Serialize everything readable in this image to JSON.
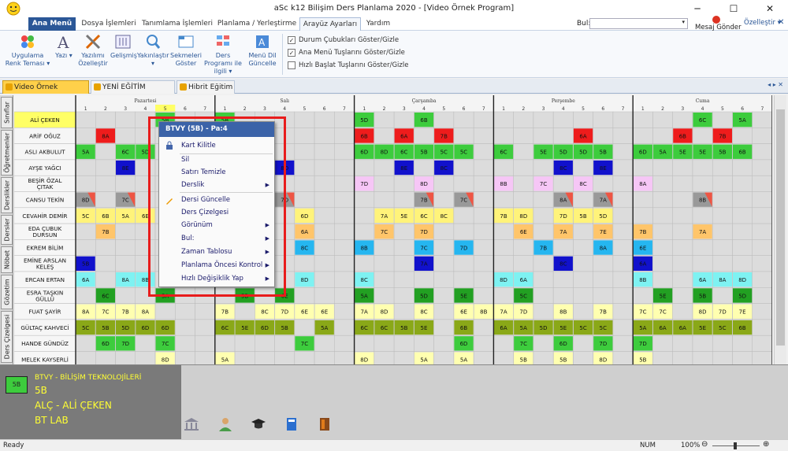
{
  "window": {
    "title": "aSc k12 Bilişim Ders Planlama 2020  - [Video Örnek Program]"
  },
  "menu": {
    "tabs": [
      "Ana Menü",
      "Dosya İşlemleri",
      "Tanımlama İşlemleri",
      "Planlama / Yerleştirme",
      "Arayüz Ayarları",
      "Yardım"
    ],
    "search_label": "Bul:",
    "message": "Mesaj Gönder",
    "settings": "Özelleştir ▾"
  },
  "ribbon": {
    "buttons": [
      "Uygulama Renk Teması ▾",
      "Yazı ▾",
      "Yazılımı Özelleştir",
      "Gelişmiş",
      "Yakınlaştır ▾",
      "Sekmeleri Göster",
      "Ders Programı ile ilgili ▾",
      "Menü Dil Güncelle"
    ],
    "checks": [
      {
        "label": "Durum Çubukları Göster/Gizle",
        "checked": true
      },
      {
        "label": "Ana Menü Tuşlarını Göster/Gizle",
        "checked": true
      },
      {
        "label": "Hızlı Başlat Tuşlarını Göster/Gizle",
        "checked": false
      }
    ]
  },
  "doctabs": [
    "Video Örnek Program",
    "YENİ EĞİTİM SİSTEMİ",
    "Hibrit Eğitim"
  ],
  "sidebar": [
    "Sınıflar",
    "Öğretmenler",
    "Derslikler",
    "Dersler",
    "Nöbet",
    "Gözetim",
    "Ders Çizelgesi"
  ],
  "days": [
    "Pazartesi",
    "Salı",
    "Çarşamba",
    "Perşembe",
    "Cuma"
  ],
  "periods": [
    "1",
    "2",
    "3",
    "4",
    "5",
    "6",
    "7"
  ],
  "teachers": [
    "ALİ ÇEKEN",
    "ARİF OĞUZ",
    "ASLI AKBULUT",
    "AYŞE YAĞCI",
    "BEŞİR ÖZAL ÇITAK",
    "CANSU TEKİN",
    "CEVAHİR DEMİR",
    "EDA ÇUBUK DURSUN",
    "EKREM BİLİM",
    "EMİNE ARSLAN KELEŞ",
    "ERCAN ERTAN",
    "ESRA TAŞKIN GÜLLÜ",
    "FUAT ŞAYİR",
    "GÜLTAÇ KAHVECİ",
    "HANDE GÜNDÜZ",
    "MELEK KAYSERLİ"
  ],
  "schedule": [
    {
      "row": 0,
      "color": "#3dcc3d",
      "cells": [
        [
          0,
          4,
          "5B"
        ],
        [
          1,
          0,
          "5B"
        ],
        [
          2,
          0,
          "5D"
        ],
        [
          2,
          3,
          "6B"
        ],
        [
          4,
          3,
          "6C"
        ],
        [
          4,
          5,
          "5A"
        ]
      ]
    },
    {
      "row": 1,
      "color": "#ee1c1c",
      "cells": [
        [
          0,
          1,
          "8A"
        ],
        [
          2,
          0,
          "6B"
        ],
        [
          2,
          2,
          "6A"
        ],
        [
          2,
          4,
          "7B"
        ],
        [
          3,
          4,
          "6A"
        ],
        [
          4,
          2,
          "6B"
        ],
        [
          4,
          4,
          "7B"
        ]
      ]
    },
    {
      "row": 2,
      "color": "#3dcc3d",
      "cells": [
        [
          0,
          0,
          "5A"
        ],
        [
          0,
          2,
          "6C"
        ],
        [
          0,
          3,
          "5D"
        ],
        [
          2,
          0,
          "6D"
        ],
        [
          2,
          1,
          "8D"
        ],
        [
          2,
          2,
          "6C"
        ],
        [
          2,
          3,
          "5B"
        ],
        [
          2,
          4,
          "5C"
        ],
        [
          2,
          5,
          "5C"
        ],
        [
          3,
          0,
          "6C"
        ],
        [
          3,
          2,
          "5E"
        ],
        [
          3,
          3,
          "5D"
        ],
        [
          3,
          4,
          "5D"
        ],
        [
          3,
          5,
          "5B"
        ],
        [
          4,
          0,
          "6D"
        ],
        [
          4,
          1,
          "5A"
        ],
        [
          4,
          2,
          "5E"
        ],
        [
          4,
          3,
          "5E"
        ],
        [
          4,
          4,
          "5B"
        ],
        [
          4,
          5,
          "6B"
        ]
      ]
    },
    {
      "row": 3,
      "color": "#1111cc",
      "cells": [
        [
          0,
          2,
          "8E"
        ],
        [
          1,
          3,
          "8D"
        ],
        [
          2,
          2,
          "8E"
        ],
        [
          2,
          4,
          "8C"
        ],
        [
          3,
          3,
          "8C"
        ],
        [
          3,
          5,
          "8E"
        ]
      ]
    },
    {
      "row": 4,
      "color": "#f6c6f6",
      "cells": [
        [
          2,
          0,
          "7D"
        ],
        [
          2,
          3,
          "8D"
        ],
        [
          3,
          0,
          "8B"
        ],
        [
          3,
          2,
          "7C"
        ],
        [
          3,
          4,
          "8C"
        ],
        [
          4,
          0,
          "8A"
        ]
      ]
    },
    {
      "row": 5,
      "color": "#999999",
      "cells": [
        [
          0,
          0,
          "8D"
        ],
        [
          0,
          2,
          "7C"
        ],
        [
          1,
          3,
          "7D"
        ],
        [
          2,
          3,
          "7B"
        ],
        [
          2,
          5,
          "7C"
        ],
        [
          3,
          3,
          "8A"
        ],
        [
          3,
          5,
          "7A"
        ],
        [
          4,
          3,
          "8B"
        ]
      ]
    },
    {
      "row": 6,
      "color": "#fff37a",
      "cells": [
        [
          0,
          0,
          "5C"
        ],
        [
          0,
          1,
          "6B"
        ],
        [
          0,
          2,
          "5A"
        ],
        [
          0,
          3,
          "6E"
        ],
        [
          1,
          4,
          "6D"
        ],
        [
          2,
          1,
          "7A"
        ],
        [
          2,
          2,
          "5E"
        ],
        [
          2,
          3,
          "6C"
        ],
        [
          2,
          4,
          "8C"
        ],
        [
          3,
          0,
          "7B"
        ],
        [
          3,
          1,
          "8D"
        ],
        [
          3,
          3,
          "7D"
        ],
        [
          3,
          4,
          "5B"
        ],
        [
          3,
          5,
          "5D"
        ]
      ]
    },
    {
      "row": 7,
      "color": "#ffc56a",
      "cells": [
        [
          0,
          1,
          "7B"
        ],
        [
          1,
          4,
          "6A"
        ],
        [
          2,
          1,
          "7C"
        ],
        [
          2,
          3,
          "7D"
        ],
        [
          3,
          1,
          "6E"
        ],
        [
          3,
          3,
          "7A"
        ],
        [
          3,
          5,
          "7E"
        ],
        [
          4,
          0,
          "7B"
        ],
        [
          4,
          3,
          "7A"
        ]
      ]
    },
    {
      "row": 8,
      "color": "#25b6f0",
      "cells": [
        [
          1,
          4,
          "8C"
        ],
        [
          2,
          0,
          "8B"
        ],
        [
          2,
          3,
          "7C"
        ],
        [
          2,
          5,
          "7D"
        ],
        [
          3,
          2,
          "7B"
        ],
        [
          3,
          5,
          "8A"
        ],
        [
          4,
          0,
          "6E"
        ]
      ]
    },
    {
      "row": 9,
      "color": "#1111cc",
      "cells": [
        [
          0,
          0,
          "5B"
        ],
        [
          2,
          3,
          "7A"
        ],
        [
          3,
          3,
          "8C"
        ],
        [
          4,
          0,
          "6A"
        ]
      ]
    },
    {
      "row": 10,
      "color": "#7ef2f2",
      "cells": [
        [
          0,
          0,
          "6A"
        ],
        [
          0,
          2,
          "8A"
        ],
        [
          0,
          3,
          "8B"
        ],
        [
          1,
          4,
          "8D"
        ],
        [
          2,
          0,
          "8C"
        ],
        [
          3,
          0,
          "8D"
        ],
        [
          3,
          1,
          "6A"
        ],
        [
          4,
          0,
          "8B"
        ],
        [
          4,
          3,
          "6A"
        ],
        [
          4,
          4,
          "8A"
        ],
        [
          4,
          5,
          "8D"
        ]
      ]
    },
    {
      "row": 11,
      "color": "#22a022",
      "cells": [
        [
          0,
          1,
          "6C"
        ],
        [
          0,
          4,
          "5A"
        ],
        [
          1,
          1,
          "5B"
        ],
        [
          1,
          3,
          "6E"
        ],
        [
          2,
          0,
          "5A"
        ],
        [
          2,
          3,
          "5D"
        ],
        [
          2,
          5,
          "5E"
        ],
        [
          3,
          1,
          "5C"
        ],
        [
          4,
          1,
          "5E"
        ],
        [
          4,
          3,
          "5B"
        ],
        [
          4,
          5,
          "5D"
        ]
      ]
    },
    {
      "row": 12,
      "color": "#ffffb0",
      "cells": [
        [
          0,
          0,
          "8A"
        ],
        [
          0,
          1,
          "7C"
        ],
        [
          0,
          2,
          "7B"
        ],
        [
          0,
          3,
          "8A"
        ],
        [
          1,
          0,
          "7B"
        ],
        [
          1,
          2,
          "8C"
        ],
        [
          1,
          3,
          "7D"
        ],
        [
          1,
          4,
          "6E"
        ],
        [
          1,
          5,
          "6E"
        ],
        [
          2,
          0,
          "7A"
        ],
        [
          2,
          1,
          "8D"
        ],
        [
          2,
          3,
          "8C"
        ],
        [
          2,
          5,
          "6E"
        ],
        [
          2,
          6,
          "8B"
        ],
        [
          3,
          0,
          "7A"
        ],
        [
          3,
          1,
          "7D"
        ],
        [
          3,
          3,
          "8B"
        ],
        [
          3,
          5,
          "7B"
        ],
        [
          4,
          0,
          "7C"
        ],
        [
          4,
          1,
          "7C"
        ],
        [
          4,
          3,
          "8D"
        ],
        [
          4,
          4,
          "7D"
        ],
        [
          4,
          5,
          "7E"
        ]
      ]
    },
    {
      "row": 13,
      "color": "#8aa818",
      "cells": [
        [
          0,
          0,
          "5C"
        ],
        [
          0,
          1,
          "5B"
        ],
        [
          0,
          2,
          "5D"
        ],
        [
          0,
          3,
          "6D"
        ],
        [
          0,
          4,
          "6D"
        ],
        [
          1,
          0,
          "6C"
        ],
        [
          1,
          1,
          "5E"
        ],
        [
          1,
          2,
          "6D"
        ],
        [
          1,
          3,
          "5B"
        ],
        [
          1,
          5,
          "5A"
        ],
        [
          2,
          0,
          "6C"
        ],
        [
          2,
          1,
          "6C"
        ],
        [
          2,
          2,
          "5B"
        ],
        [
          2,
          3,
          "5E"
        ],
        [
          2,
          5,
          "6B"
        ],
        [
          3,
          0,
          "6A"
        ],
        [
          3,
          1,
          "5A"
        ],
        [
          3,
          2,
          "5D"
        ],
        [
          3,
          3,
          "5E"
        ],
        [
          3,
          4,
          "5C"
        ],
        [
          3,
          5,
          "5C"
        ],
        [
          4,
          0,
          "5A"
        ],
        [
          4,
          1,
          "6A"
        ],
        [
          4,
          2,
          "6A"
        ],
        [
          4,
          3,
          "5E"
        ],
        [
          4,
          4,
          "5C"
        ],
        [
          4,
          5,
          "6B"
        ]
      ]
    },
    {
      "row": 14,
      "color": "#3dcc3d",
      "cells": [
        [
          0,
          1,
          "6D"
        ],
        [
          0,
          2,
          "7D"
        ],
        [
          0,
          4,
          "7C"
        ],
        [
          1,
          4,
          "7C"
        ],
        [
          2,
          5,
          "6D"
        ],
        [
          3,
          1,
          "7C"
        ],
        [
          3,
          3,
          "6D"
        ],
        [
          3,
          5,
          "7D"
        ],
        [
          4,
          0,
          "7D"
        ]
      ]
    },
    {
      "row": 15,
      "color": "#ffffb0",
      "cells": [
        [
          0,
          4,
          "8D"
        ],
        [
          1,
          0,
          "5A"
        ],
        [
          2,
          0,
          "8D"
        ],
        [
          2,
          3,
          "5A"
        ],
        [
          2,
          5,
          "5A"
        ],
        [
          3,
          1,
          "5B"
        ],
        [
          3,
          3,
          "5B"
        ],
        [
          3,
          5,
          "8D"
        ],
        [
          4,
          0,
          "5B"
        ]
      ]
    }
  ],
  "context_menu": {
    "header": "BTVY (5B) - Pa:4",
    "items": [
      "Kart Kilitle",
      "Sil",
      "Satırı Temizle",
      "Derslik",
      "Dersi Güncelle",
      "Ders Çizelgesi",
      "Görünüm",
      "Bul:",
      "Zaman Tablosu",
      "Planlama Öncesi Kontrol",
      "Hızlı Değişiklik Yap"
    ],
    "submenu": [
      false,
      false,
      false,
      true,
      false,
      false,
      true,
      true,
      true,
      true,
      true
    ]
  },
  "info": {
    "badge": "5B",
    "title": "BTVY - BİLİŞİM TEKNOLOJİLERİ",
    "class": "5B",
    "teacher": "ALÇ - ALİ ÇEKEN",
    "room": "BT LAB"
  },
  "status": {
    "left": "Ready",
    "num": "NUM",
    "zoom": "100%"
  },
  "colors": {
    "brand": "#2b5797",
    "highlight": "#ffff66",
    "accent_red": "#e81c1c"
  }
}
